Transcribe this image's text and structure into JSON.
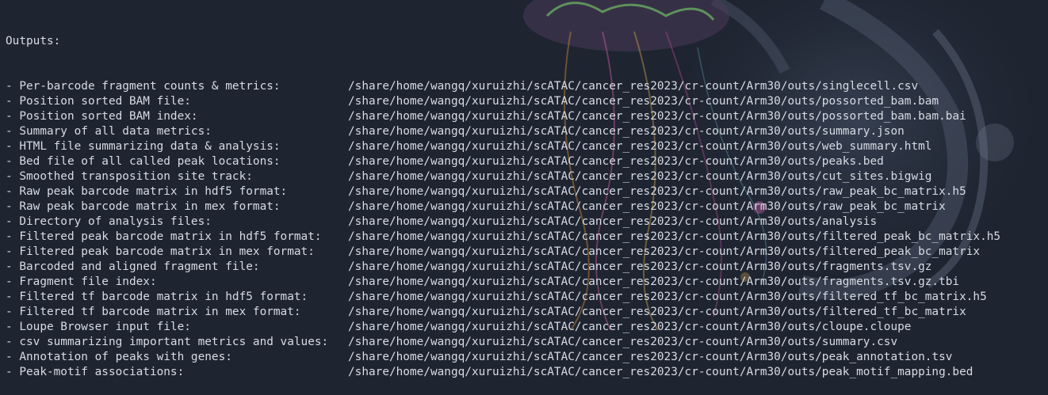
{
  "terminal": {
    "heading": "Outputs:",
    "colors": {
      "background": "#1e2430",
      "text": "#d7dce4"
    },
    "rows": [
      {
        "label": "- Per-barcode fragment counts & metrics:",
        "path": "/share/home/wangq/xuruizhi/scATAC/cancer_res2023/cr-count/Arm30/outs/singlecell.csv"
      },
      {
        "label": "- Position sorted BAM file:",
        "path": "/share/home/wangq/xuruizhi/scATAC/cancer_res2023/cr-count/Arm30/outs/possorted_bam.bam"
      },
      {
        "label": "- Position sorted BAM index:",
        "path": "/share/home/wangq/xuruizhi/scATAC/cancer_res2023/cr-count/Arm30/outs/possorted_bam.bam.bai"
      },
      {
        "label": "- Summary of all data metrics:",
        "path": "/share/home/wangq/xuruizhi/scATAC/cancer_res2023/cr-count/Arm30/outs/summary.json"
      },
      {
        "label": "- HTML file summarizing data & analysis:",
        "path": "/share/home/wangq/xuruizhi/scATAC/cancer_res2023/cr-count/Arm30/outs/web_summary.html"
      },
      {
        "label": "- Bed file of all called peak locations:",
        "path": "/share/home/wangq/xuruizhi/scATAC/cancer_res2023/cr-count/Arm30/outs/peaks.bed"
      },
      {
        "label": "- Smoothed transposition site track:",
        "path": "/share/home/wangq/xuruizhi/scATAC/cancer_res2023/cr-count/Arm30/outs/cut_sites.bigwig"
      },
      {
        "label": "- Raw peak barcode matrix in hdf5 format:",
        "path": "/share/home/wangq/xuruizhi/scATAC/cancer_res2023/cr-count/Arm30/outs/raw_peak_bc_matrix.h5"
      },
      {
        "label": "- Raw peak barcode matrix in mex format:",
        "path": "/share/home/wangq/xuruizhi/scATAC/cancer_res2023/cr-count/Arm30/outs/raw_peak_bc_matrix"
      },
      {
        "label": "- Directory of analysis files:",
        "path": "/share/home/wangq/xuruizhi/scATAC/cancer_res2023/cr-count/Arm30/outs/analysis"
      },
      {
        "label": "- Filtered peak barcode matrix in hdf5 format:",
        "path": "/share/home/wangq/xuruizhi/scATAC/cancer_res2023/cr-count/Arm30/outs/filtered_peak_bc_matrix.h5"
      },
      {
        "label": "- Filtered peak barcode matrix in mex format:",
        "path": "/share/home/wangq/xuruizhi/scATAC/cancer_res2023/cr-count/Arm30/outs/filtered_peak_bc_matrix"
      },
      {
        "label": "- Barcoded and aligned fragment file:",
        "path": "/share/home/wangq/xuruizhi/scATAC/cancer_res2023/cr-count/Arm30/outs/fragments.tsv.gz"
      },
      {
        "label": "- Fragment file index:",
        "path": "/share/home/wangq/xuruizhi/scATAC/cancer_res2023/cr-count/Arm30/outs/fragments.tsv.gz.tbi"
      },
      {
        "label": "- Filtered tf barcode matrix in hdf5 format:",
        "path": "/share/home/wangq/xuruizhi/scATAC/cancer_res2023/cr-count/Arm30/outs/filtered_tf_bc_matrix.h5"
      },
      {
        "label": "- Filtered tf barcode matrix in mex format:",
        "path": "/share/home/wangq/xuruizhi/scATAC/cancer_res2023/cr-count/Arm30/outs/filtered_tf_bc_matrix"
      },
      {
        "label": "- Loupe Browser input file:",
        "path": "/share/home/wangq/xuruizhi/scATAC/cancer_res2023/cr-count/Arm30/outs/cloupe.cloupe"
      },
      {
        "label": "- csv summarizing important metrics and values:",
        "path": "/share/home/wangq/xuruizhi/scATAC/cancer_res2023/cr-count/Arm30/outs/summary.csv"
      },
      {
        "label": "- Annotation of peaks with genes:",
        "path": "/share/home/wangq/xuruizhi/scATAC/cancer_res2023/cr-count/Arm30/outs/peak_annotation.tsv"
      },
      {
        "label": "- Peak-motif associations:",
        "path": "/share/home/wangq/xuruizhi/scATAC/cancer_res2023/cr-count/Arm30/outs/peak_motif_mapping.bed"
      }
    ]
  }
}
